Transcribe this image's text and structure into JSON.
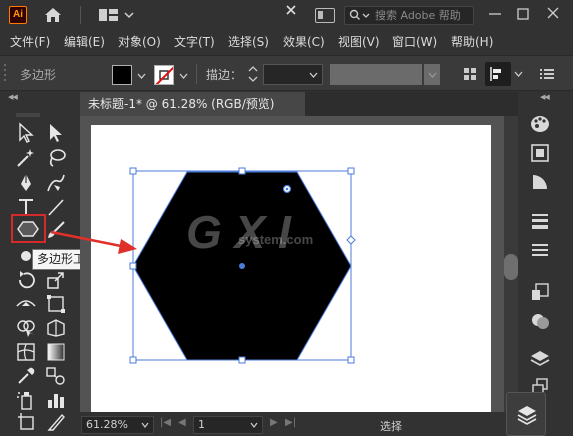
{
  "titlebar": {
    "app_logo": "Ai",
    "search_placeholder": "搜索 Adobe 帮助"
  },
  "menu": [
    {
      "label": "文件(F)"
    },
    {
      "label": "编辑(E)"
    },
    {
      "label": "对象(O)"
    },
    {
      "label": "文字(T)"
    },
    {
      "label": "选择(S)"
    },
    {
      "label": "效果(C)"
    },
    {
      "label": "视图(V)"
    },
    {
      "label": "窗口(W)"
    },
    {
      "label": "帮助(H)"
    }
  ],
  "control_bar": {
    "object_type": "多边形",
    "stroke_label": "描边："
  },
  "document": {
    "tab_title": "未标题-1* @ 61.28% (RGB/预览)"
  },
  "tools": {
    "tooltip": "多边形工具"
  },
  "status_bar": {
    "zoom": "61.28%",
    "page": "1",
    "status_text": "选择"
  },
  "watermark": {
    "line1": "G X I",
    "line2": "system.com"
  },
  "colors": {
    "fill": "#000000",
    "stroke": "none",
    "selection": "#4a7bd8",
    "annotation": "#d42a2a"
  }
}
